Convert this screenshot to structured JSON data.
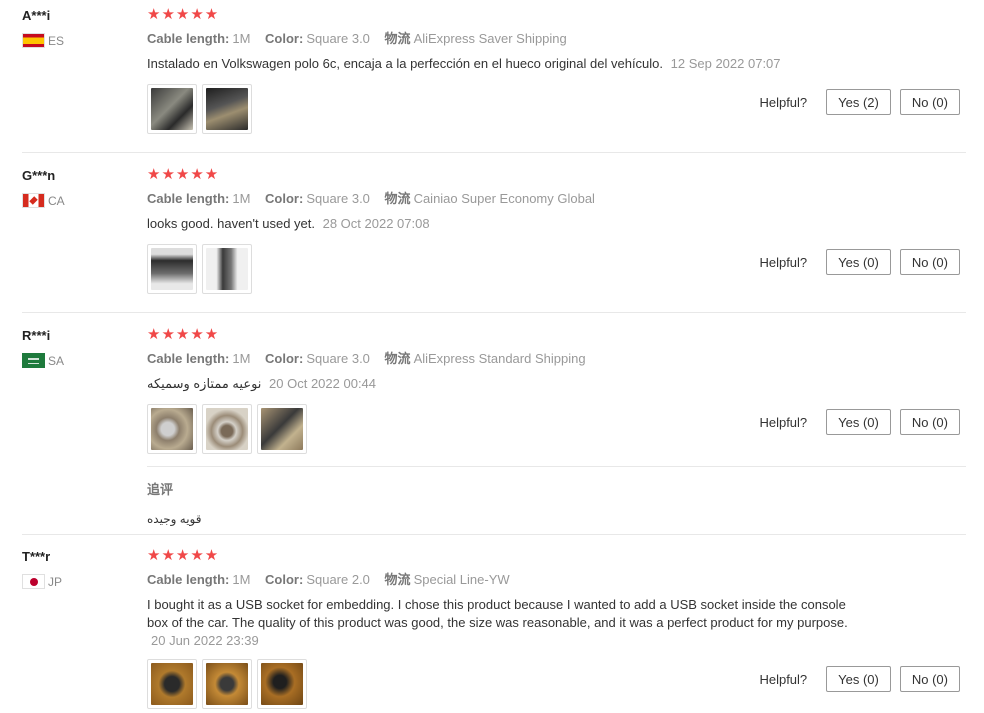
{
  "meta_labels": {
    "cable_length": "Cable length:",
    "color": "Color:",
    "shipping": "物流"
  },
  "helpful_label": "Helpful?",
  "stars": "★★★★★",
  "reviews": [
    {
      "user": "A***i",
      "country": "ES",
      "cable_length": "1M",
      "color": "Square 3.0",
      "shipping": "AliExpress Saver Shipping",
      "text": "Instalado en Volkswagen polo 6c, encaja a la perfección en el hueco original del vehículo.",
      "date": "12 Sep 2022 07:07",
      "photos": 2,
      "yes": "Yes (2)",
      "no": "No (0)"
    },
    {
      "user": "G***n",
      "country": "CA",
      "cable_length": "1M",
      "color": "Square 3.0",
      "shipping": "Cainiao Super Economy Global",
      "text": "looks good. haven't used yet.",
      "date": "28 Oct 2022 07:08",
      "photos": 2,
      "yes": "Yes (0)",
      "no": "No (0)"
    },
    {
      "user": "R***i",
      "country": "SA",
      "cable_length": "1M",
      "color": "Square 3.0",
      "shipping": "AliExpress Standard Shipping",
      "text": "نوعيه ممتازه وسميكه",
      "date": "20 Oct 2022 00:44",
      "photos": 3,
      "yes": "Yes (0)",
      "no": "No (0)",
      "additional_title": "追评",
      "additional_text": "قويه وجيده"
    },
    {
      "user": "T***r",
      "country": "JP",
      "cable_length": "1M",
      "color": "Square 2.0",
      "shipping": "Special Line-YW",
      "text": "I bought it as a USB socket for embedding. I chose this product because I wanted to add a USB socket inside the console box of the car. The quality of this product was good, the size was reasonable, and it was a perfect product for my purpose.",
      "date": "20 Jun 2022 23:39",
      "photos": 3,
      "yes": "Yes (0)",
      "no": "No (0)"
    }
  ],
  "colors": {
    "star": "#f04848",
    "muted": "#999999",
    "separator": "#e8e8e8"
  }
}
